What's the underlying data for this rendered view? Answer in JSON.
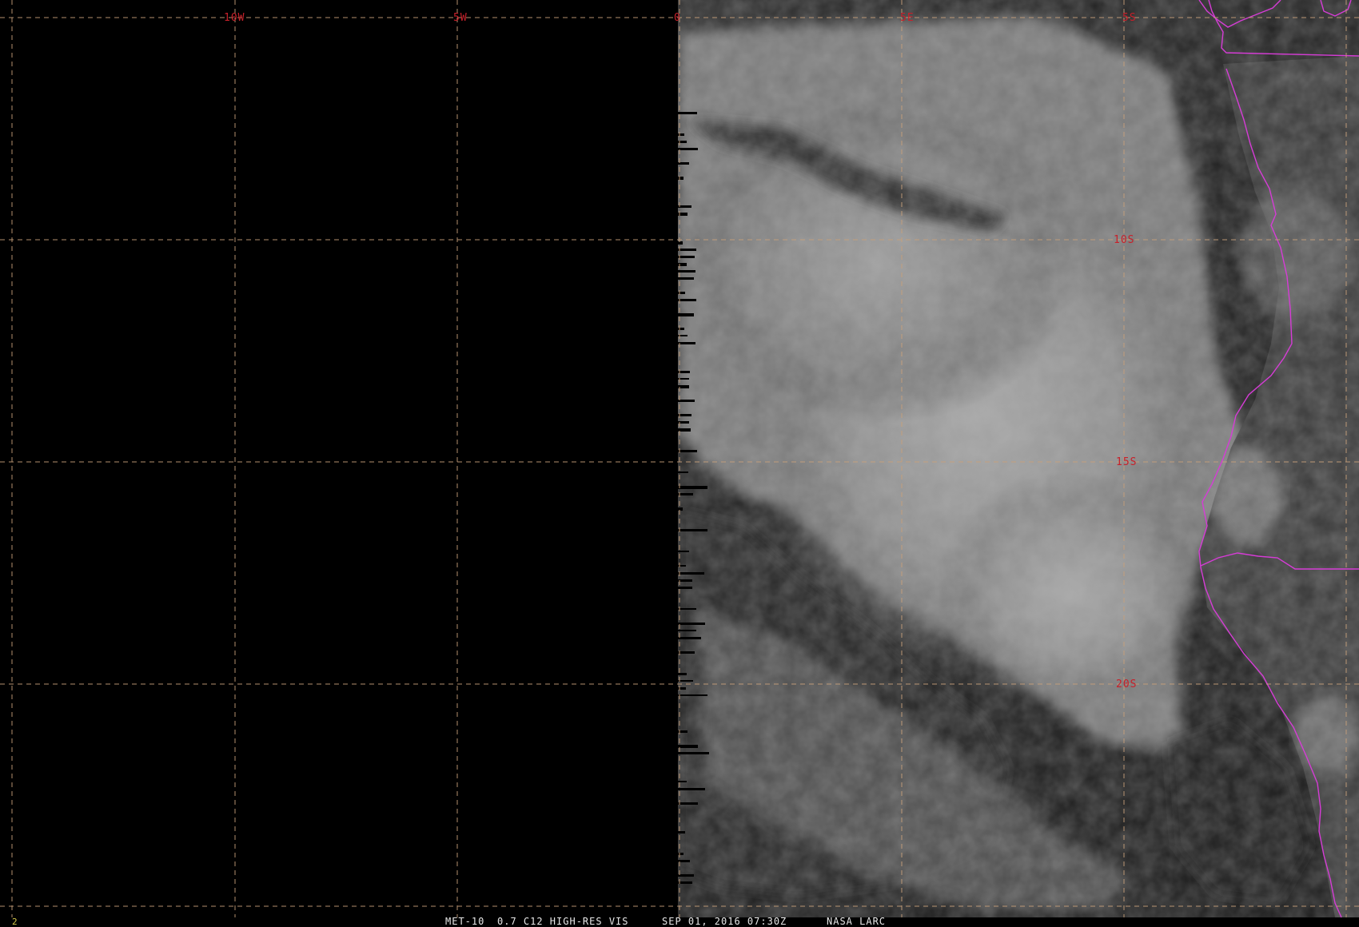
{
  "image": {
    "satellite": "MET-10",
    "channel": "0.7 C12 HIGH-RES VIS",
    "date_time": "SEP 01, 2016 07:30Z",
    "source": "NASA LARC",
    "frame_number": "2"
  },
  "grid": {
    "longitude_labels": [
      "10W",
      "5W",
      "0",
      "5E",
      "5S"
    ],
    "latitude_labels": [
      "10S",
      "15S",
      "20S"
    ]
  },
  "colors": {
    "background": "#000000",
    "grid_line": "#c8a07a",
    "grid_label": "#c8202a",
    "coastline": "#d63cd6",
    "footer_text": "#e8e8e8",
    "frame_number": "#d4c84a"
  }
}
